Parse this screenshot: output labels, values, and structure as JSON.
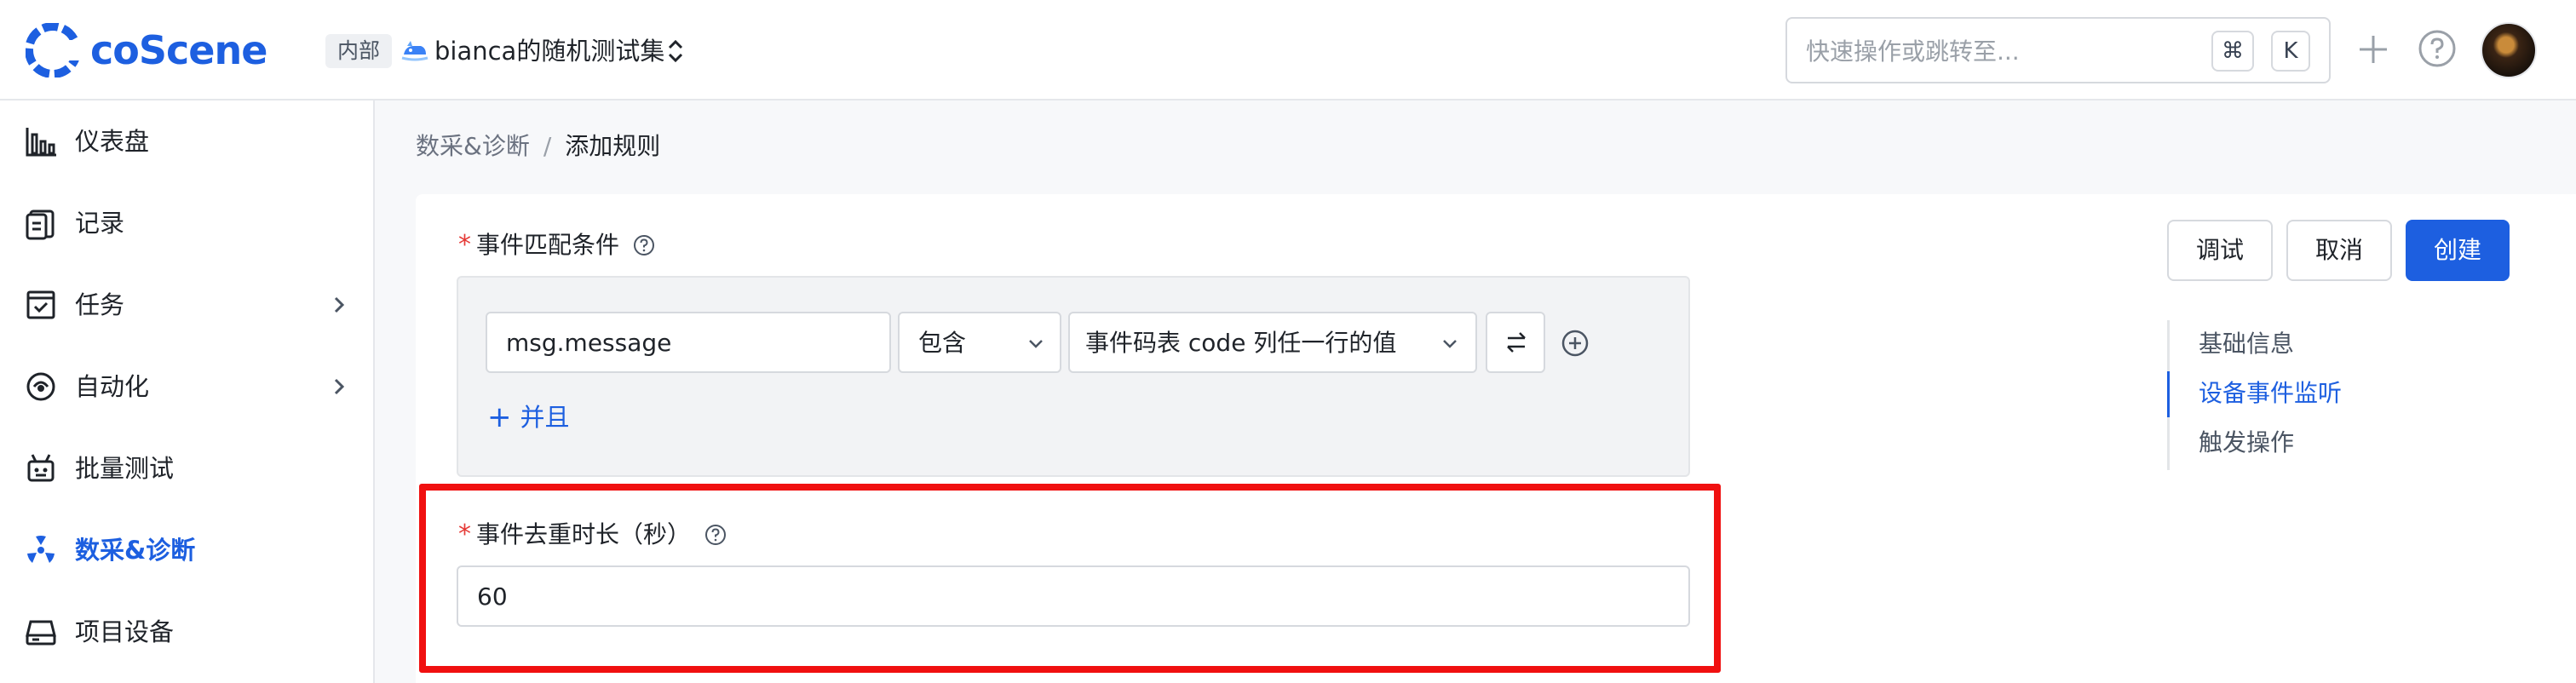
{
  "app": {
    "logo_text": "coScene",
    "brand_color": "#1d5fe0"
  },
  "header": {
    "visibility_tag": "内部",
    "project_name": "bianca的随机测试集",
    "search": {
      "placeholder": "快速操作或跳转至...",
      "shortcut_key_1": "⌘",
      "shortcut_key_2": "K"
    },
    "icons": [
      "coscene-logo-icon",
      "project-icon",
      "switch-icon",
      "plus-icon",
      "help-icon",
      "user-avatar"
    ]
  },
  "sidebar": {
    "items": [
      {
        "label": "仪表盘",
        "icon": "bar-chart-icon",
        "has_children": false,
        "active": false
      },
      {
        "label": "记录",
        "icon": "clipboard-icon",
        "has_children": false,
        "active": false
      },
      {
        "label": "任务",
        "icon": "task-icon",
        "has_children": true,
        "active": false
      },
      {
        "label": "自动化",
        "icon": "automation-icon",
        "has_children": true,
        "active": false
      },
      {
        "label": "批量测试",
        "icon": "robot-icon",
        "has_children": false,
        "active": false
      },
      {
        "label": "数采&诊断",
        "icon": "diagnosis-icon",
        "has_children": false,
        "active": true
      },
      {
        "label": "项目设备",
        "icon": "device-icon",
        "has_children": false,
        "active": false
      }
    ]
  },
  "breadcrumb": {
    "parent": "数采&诊断",
    "separator": "/",
    "current": "添加规则"
  },
  "form": {
    "match_condition": {
      "label": "事件匹配条件",
      "required_mark": "*",
      "field_value": "msg.message",
      "operator_value": "包含",
      "target_value": "事件码表 code 列任一行的值",
      "and_button_label": "并且",
      "and_button_plus": "+"
    },
    "dedup_duration": {
      "label": "事件去重时长（秒）",
      "required_mark": "*",
      "value": "60"
    }
  },
  "actions": {
    "debug_label": "调试",
    "cancel_label": "取消",
    "create_label": "创建"
  },
  "anchor_nav": {
    "items": [
      "基础信息",
      "设备事件监听",
      "触发操作"
    ],
    "active_index": 1
  },
  "highlight_color": "#f01010"
}
